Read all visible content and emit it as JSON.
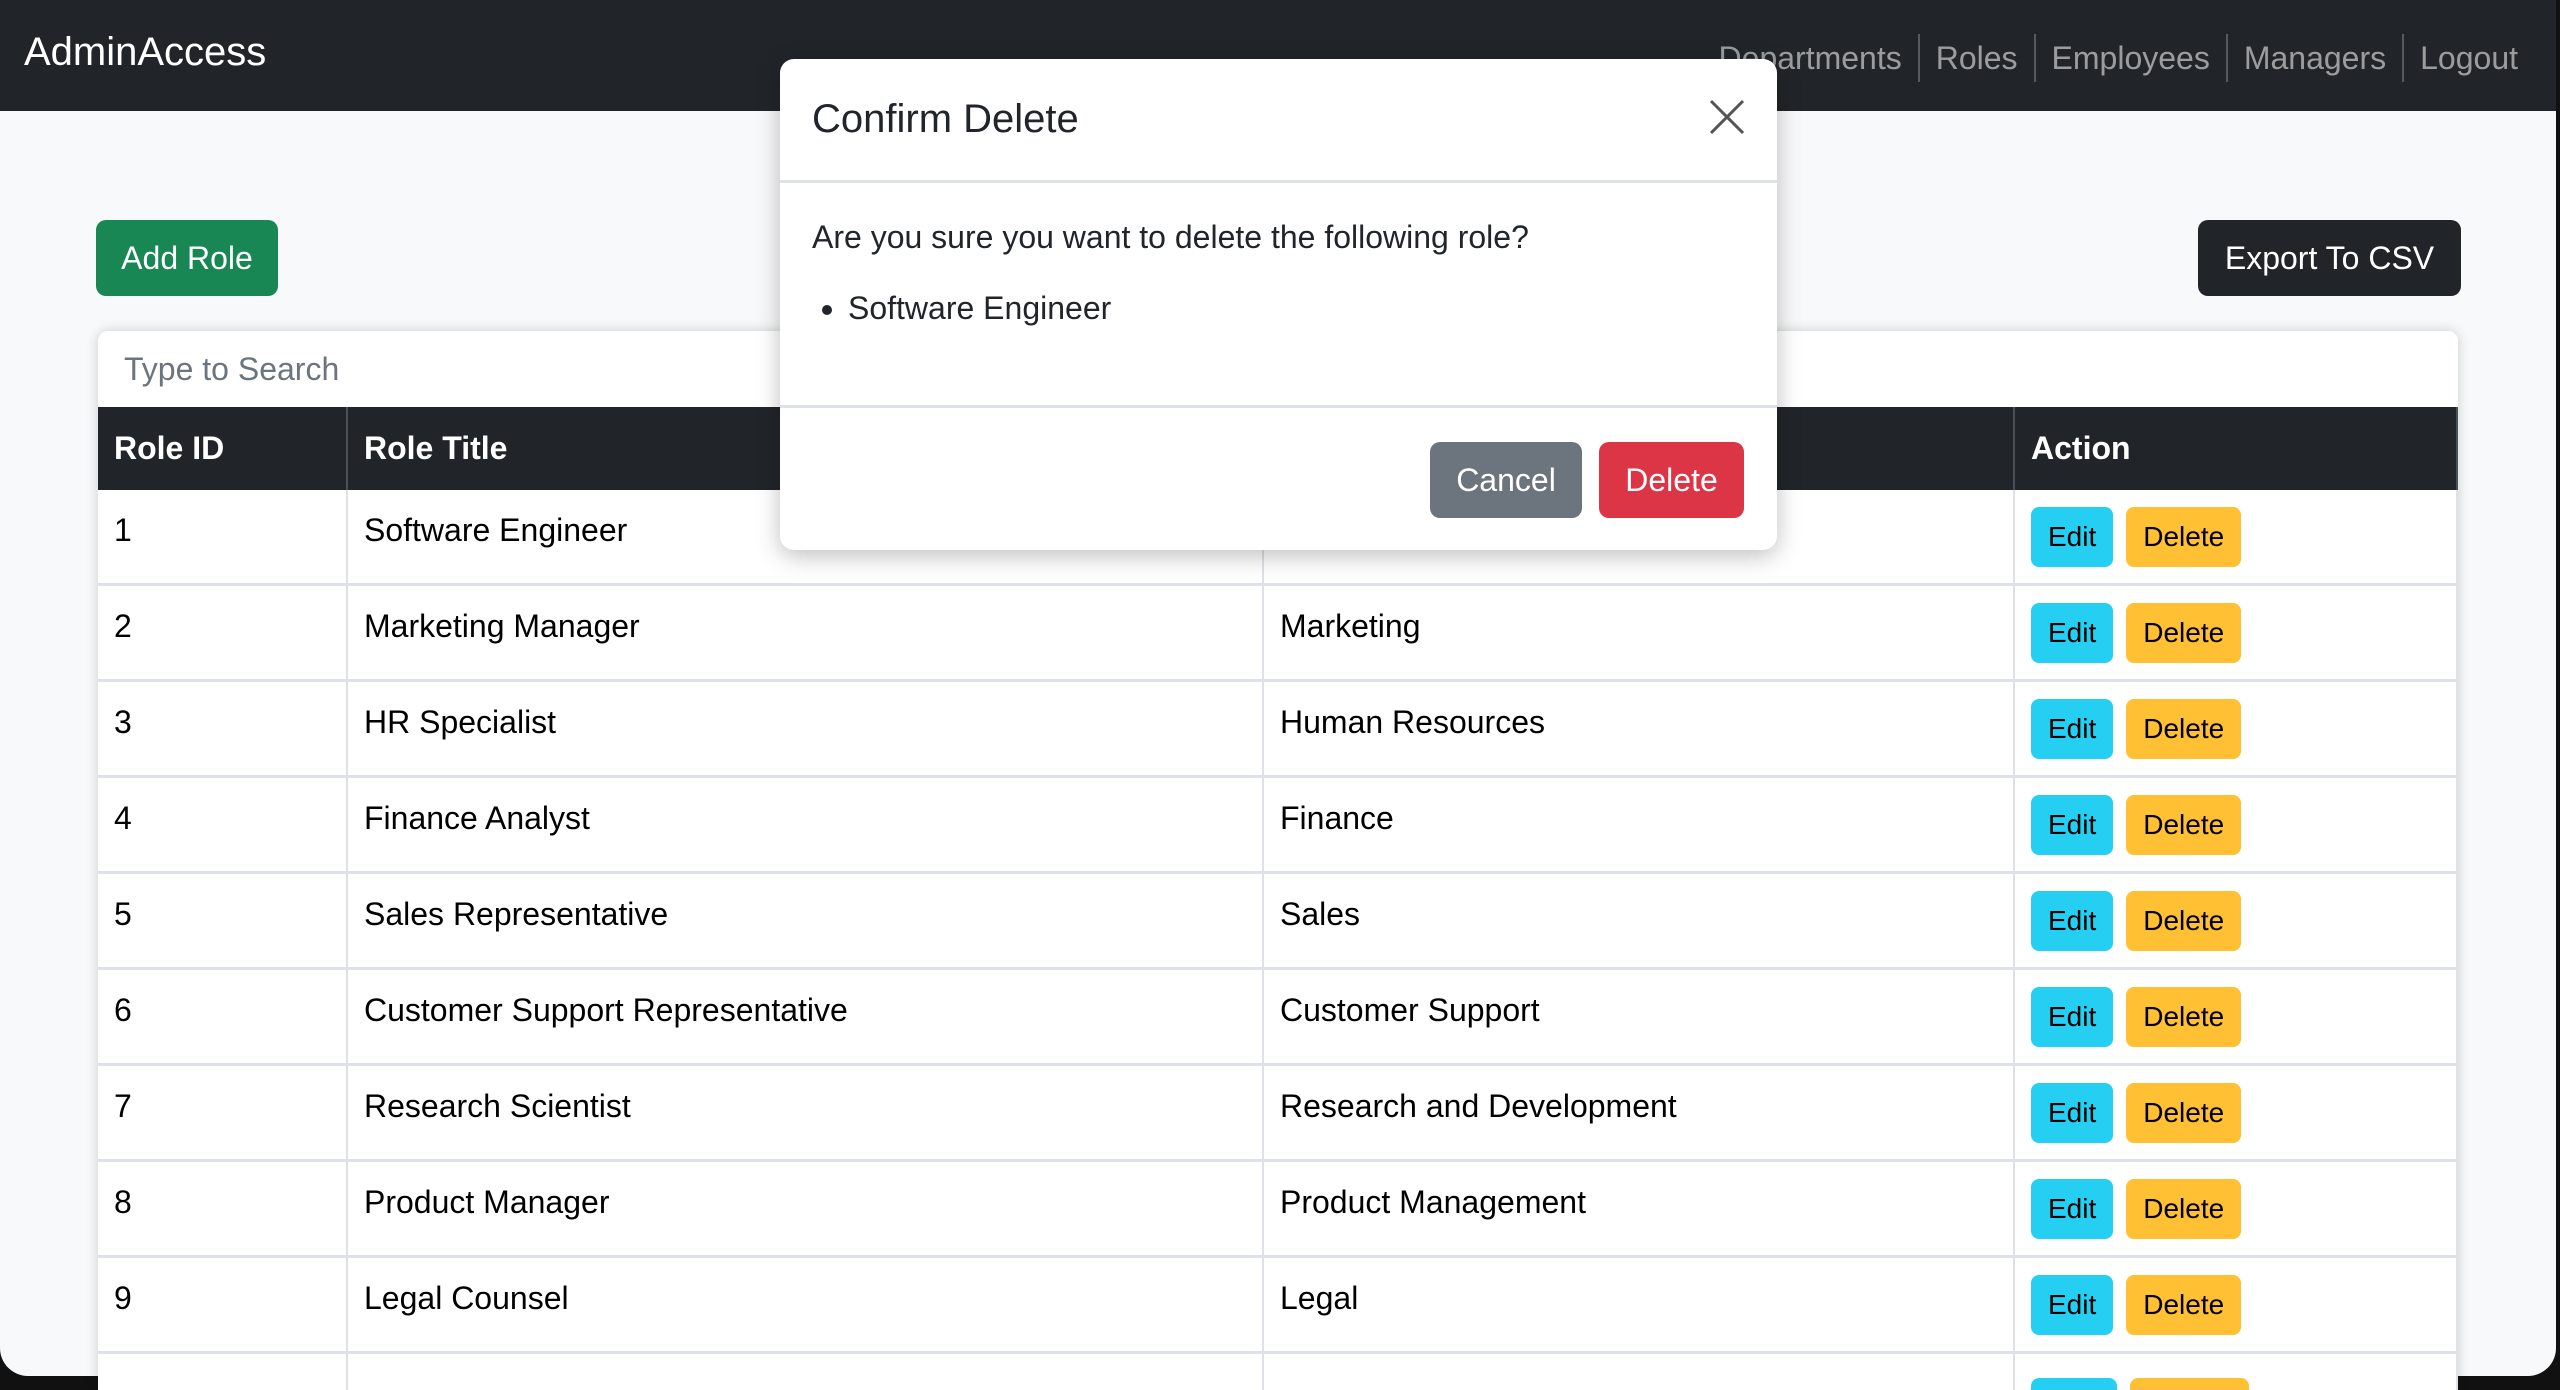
{
  "nav": {
    "brand": "AdminAccess",
    "links": [
      "Departments",
      "Roles",
      "Employees",
      "Managers",
      "Logout"
    ]
  },
  "toolbar": {
    "add_label": "Add Role",
    "export_label": "Export To CSV"
  },
  "search": {
    "placeholder": "Type to Search"
  },
  "table": {
    "headers": [
      "Role ID",
      "Role Title",
      "",
      "Action"
    ],
    "rows": [
      {
        "id": "1",
        "title": "Software Engineer",
        "dept": ""
      },
      {
        "id": "2",
        "title": "Marketing Manager",
        "dept": "Marketing"
      },
      {
        "id": "3",
        "title": "HR Specialist",
        "dept": "Human Resources"
      },
      {
        "id": "4",
        "title": "Finance Analyst",
        "dept": "Finance"
      },
      {
        "id": "5",
        "title": "Sales Representative",
        "dept": "Sales"
      },
      {
        "id": "6",
        "title": "Customer Support Representative",
        "dept": "Customer Support"
      },
      {
        "id": "7",
        "title": "Research Scientist",
        "dept": "Research and Development"
      },
      {
        "id": "8",
        "title": "Product Manager",
        "dept": "Product Management"
      },
      {
        "id": "9",
        "title": "Legal Counsel",
        "dept": "Legal"
      },
      {
        "id": "",
        "title": "",
        "dept": ""
      }
    ],
    "edit_label": "Edit",
    "delete_label": "Delete"
  },
  "modal": {
    "title": "Confirm Delete",
    "message": "Are you sure you want to delete the following role?",
    "items": [
      "Software Engineer"
    ],
    "cancel_label": "Cancel",
    "delete_label": "Delete"
  }
}
